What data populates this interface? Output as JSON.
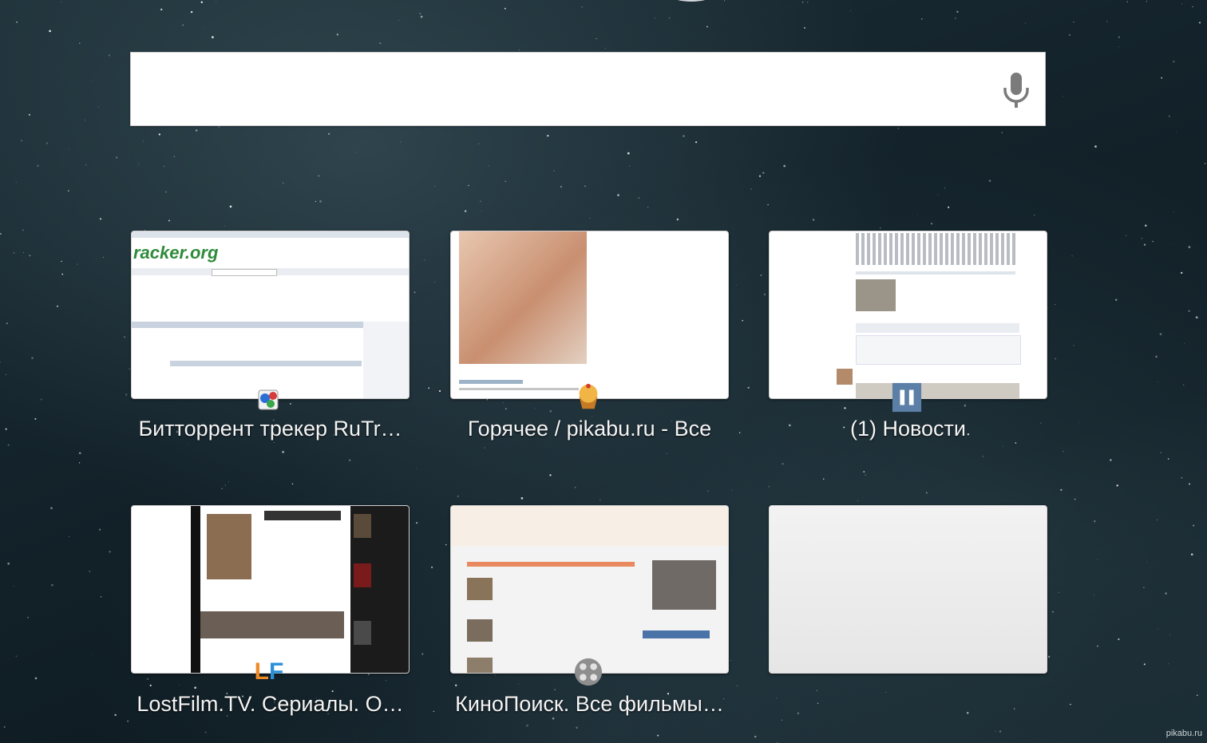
{
  "search": {
    "value": "",
    "placeholder": ""
  },
  "tiles": [
    {
      "title": "Битторрент трекер RuTr…",
      "favicon": "rutracker-icon"
    },
    {
      "title": "Горячее / pikabu.ru - Все",
      "favicon": "pikabu-cupcake-icon"
    },
    {
      "title": "(1) Новости",
      "favicon": "vk-pause-icon"
    },
    {
      "title": "LostFilm.TV. Сериалы. О…",
      "favicon": "lostfilm-icon",
      "favicon_text": "LF"
    },
    {
      "title": "КиноПоиск. Все фильмы…",
      "favicon": "kinopoisk-icon"
    },
    {
      "title": "",
      "favicon": ""
    }
  ],
  "thumb_text": {
    "rutracker_logo": "racker.org"
  },
  "watermark": "pikabu.ru",
  "colors": {
    "background": "#14232b",
    "tile_title": "#f4f4f4",
    "rutracker_logo": "#2e8b3a",
    "vk_blue": "#5b7fa6",
    "lostfilm_orange": "#f08a24",
    "lostfilm_blue": "#2b8fd8"
  }
}
